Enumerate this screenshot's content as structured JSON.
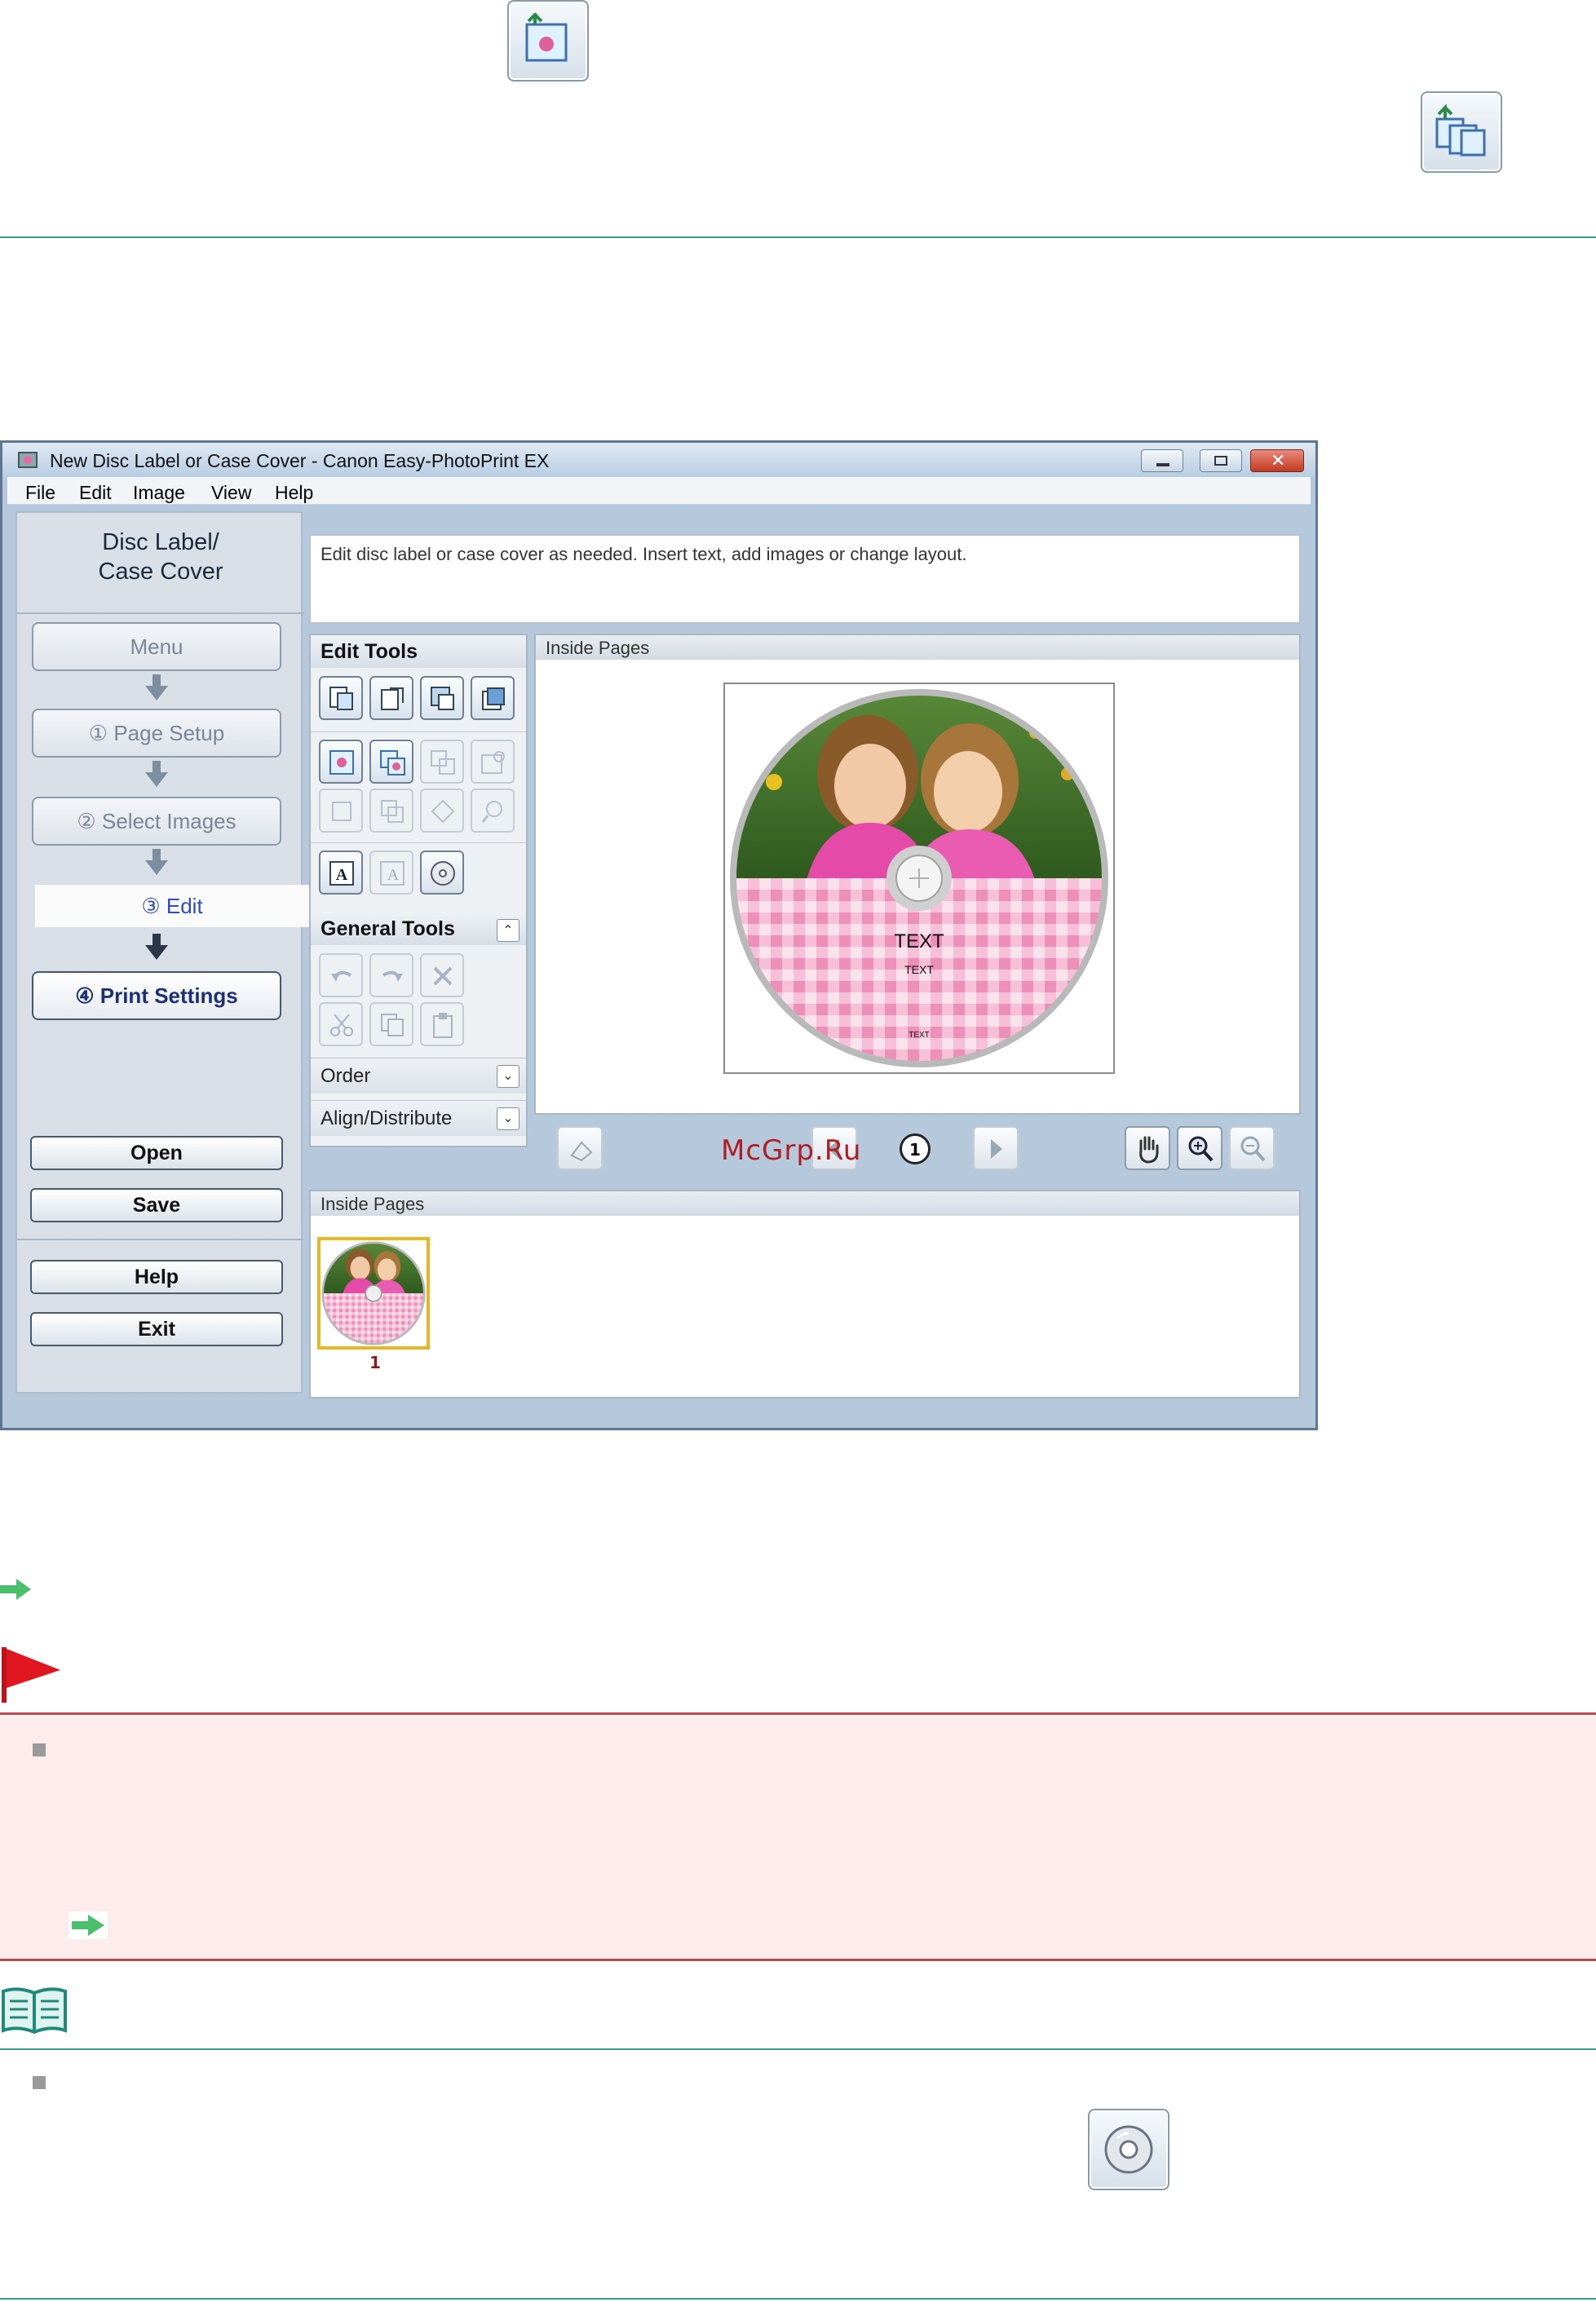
{
  "document": {
    "icons": [
      "insert-image-icon",
      "insert-images-icon",
      "disc-print-area-icon"
    ],
    "note_icon": "book-icon",
    "caution_icon": "red-flag-icon"
  },
  "app": {
    "window_title": "New Disc Label or Case Cover - Canon Easy-PhotoPrint EX",
    "menu": [
      "File",
      "Edit",
      "Image",
      "View",
      "Help"
    ],
    "panel_title_line1": "Disc Label/",
    "panel_title_line2": "Case Cover",
    "nav": {
      "menu": "Menu",
      "page_setup": "①  Page Setup",
      "select_images": "②  Select Images",
      "edit": "③        Edit",
      "print_settings": "④  Print Settings"
    },
    "buttons": {
      "open": "Open",
      "save": "Save",
      "help": "Help",
      "exit": "Exit"
    },
    "description": "Edit disc label or case cover as needed. Insert text, add images or change layout.",
    "edit_tools_title": "Edit Tools",
    "general_tools_title": "General Tools",
    "order_label": "Order",
    "align_label": "Align/Distribute",
    "preview_title": "Inside Pages",
    "thumbs_title": "Inside Pages",
    "disc_text": {
      "large": "TEXT",
      "small": "TEXT",
      "tiny": "TEXT"
    },
    "page_number": "1",
    "thumb_label": "1",
    "colors": {
      "accent": "#1d2f77",
      "selection": "#e8b820",
      "gingham": "#f4a9c8"
    }
  },
  "watermark": "McGrp.Ru"
}
